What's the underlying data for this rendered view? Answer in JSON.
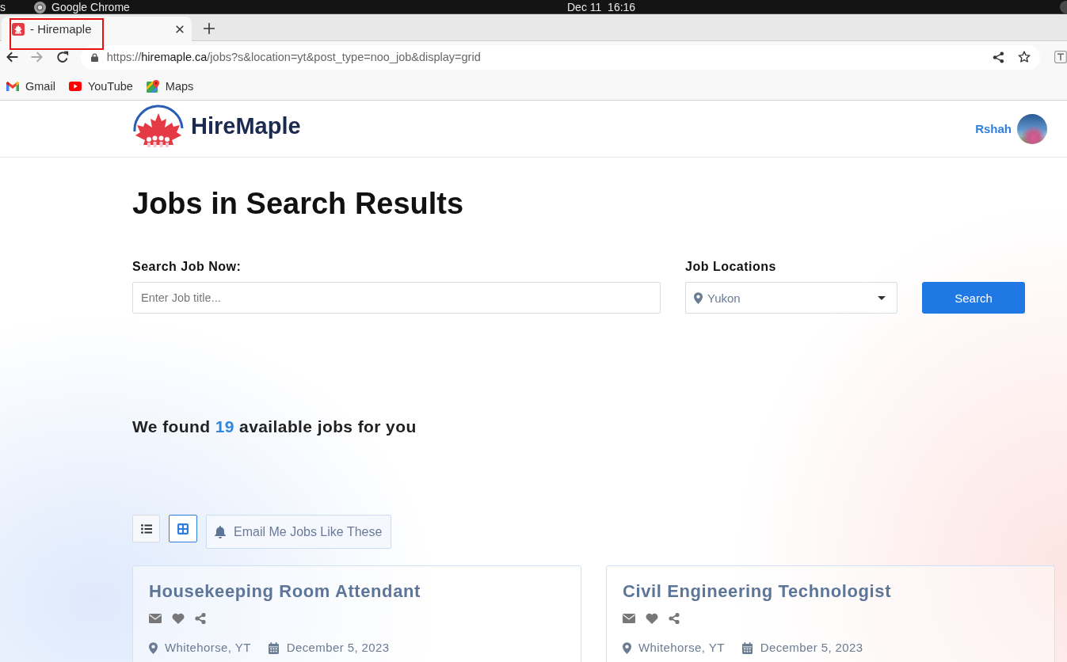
{
  "os_bar": {
    "activities": "s",
    "app_name": "Google Chrome",
    "clock": "Dec 11  16:16"
  },
  "browser": {
    "tabs": [
      {
        "title": "- Hiremaple",
        "selected": true,
        "highlighted": true
      }
    ],
    "nav_buttons": [
      {
        "kind": "back",
        "disabled": false
      },
      {
        "kind": "forward",
        "disabled": true
      },
      {
        "kind": "reload",
        "disabled": false
      }
    ],
    "address": {
      "scheme": "https://",
      "domain": "hiremaple.ca",
      "path": "/jobs?s&location=yt&post_type=noo_job&display=grid"
    },
    "bookmarks": [
      {
        "label": "Gmail",
        "kind": "gmail"
      },
      {
        "label": "YouTube",
        "kind": "youtube"
      },
      {
        "label": "Maps",
        "kind": "maps"
      }
    ]
  },
  "header": {
    "logo_text": "HireMaple",
    "user_name": "Rshah"
  },
  "page_title": "Jobs in Search Results",
  "search": {
    "keyword": {
      "label": "Search Job Now:",
      "placeholder": "Enter Job title..."
    },
    "location": {
      "label": "Job Locations",
      "value": "Yukon"
    },
    "button": "Search"
  },
  "results": {
    "before": "We found",
    "count": "19",
    "after": "available jobs for you"
  },
  "view_buttons": [
    {
      "kind": "list",
      "selected": false
    },
    {
      "kind": "grid",
      "selected": true
    }
  ],
  "alert_button": "Email Me Jobs Like These",
  "jobs": [
    {
      "title": "Housekeeping Room Attendant",
      "location": "Whitehorse, YT",
      "date": "December 5, 2023"
    },
    {
      "title": "Civil Engineering Technologist",
      "location": "Whitehorse, YT",
      "date": "December 5, 2023"
    }
  ]
}
